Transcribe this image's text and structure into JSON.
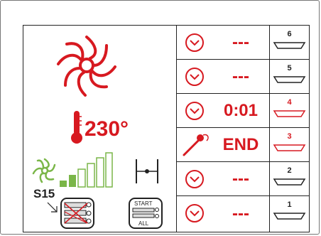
{
  "status": {
    "temperature": "230°",
    "program": "S15",
    "fan_level_bars": 5
  },
  "controls": {
    "start_label": "START",
    "all_label": "ALL"
  },
  "shelves": [
    {
      "number": "6",
      "time": "---",
      "mode": "timer",
      "active": false
    },
    {
      "number": "5",
      "time": "---",
      "mode": "timer",
      "active": false
    },
    {
      "number": "4",
      "time": "0:01",
      "mode": "timer",
      "active": true
    },
    {
      "number": "3",
      "time": "END",
      "mode": "probe",
      "active": true
    },
    {
      "number": "2",
      "time": "---",
      "mode": "timer",
      "active": false
    },
    {
      "number": "1",
      "time": "---",
      "mode": "timer",
      "active": false
    }
  ],
  "colors": {
    "accent": "#d71920",
    "green": "#7ab648",
    "text": "#222222"
  }
}
